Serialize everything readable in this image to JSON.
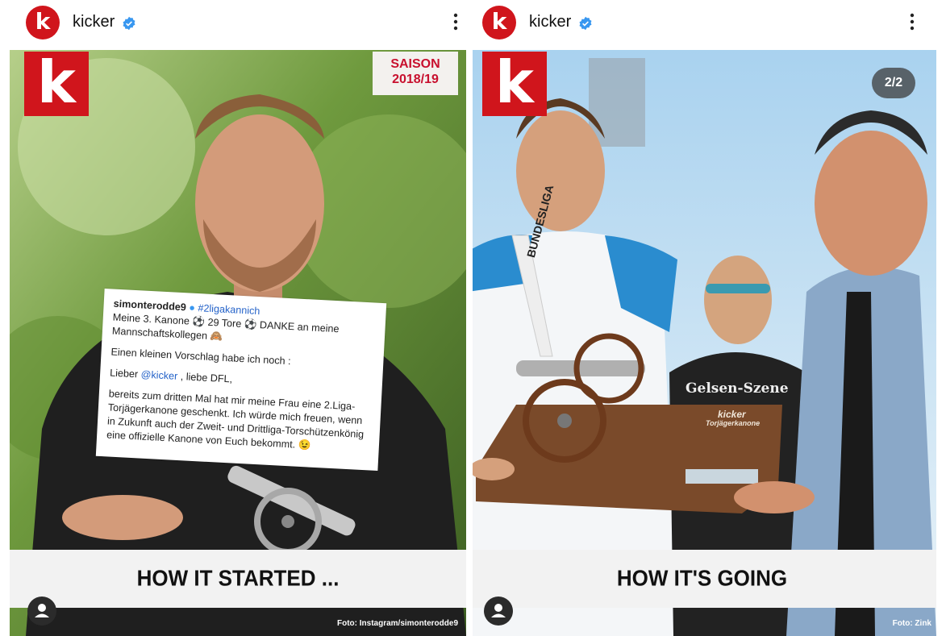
{
  "posts": [
    {
      "username": "kicker",
      "avatar_letter": "k",
      "logo_letter": "k",
      "badge": {
        "line1": "SAISON",
        "line2": "2018/19"
      },
      "caption": "HOW IT STARTED ...",
      "credit": "Foto: Instagram/simonterodde9",
      "quote": {
        "author": "simonterodde9",
        "hashtag": "#2ligakannich",
        "line1": "Meine 3. Kanone ⚽ 29 Tore ⚽ DANKE an meine Mannschaftskollegen 🙈",
        "line2": "Einen kleinen Vorschlag habe ich noch :",
        "line3_prefix": "Lieber ",
        "line3_mention": "@kicker",
        "line3_suffix": " , liebe DFL,",
        "line4": "bereits zum dritten Mal hat mir meine Frau eine 2.Liga-Torjägerkanone geschenkt. Ich würde mich freuen, wenn in Zukunft auch der Zweit- und Drittliga-Torschützenkönig eine offizielle Kanone von Euch bekommt. 😉"
      }
    },
    {
      "username": "kicker",
      "avatar_letter": "k",
      "logo_letter": "k",
      "counter": "2/2",
      "caption": "HOW IT'S GOING",
      "credit": "Foto: Zink",
      "plaque_title": "kicker",
      "plaque_subtitle": "Torjägerkanone",
      "shirt_text": "Gelsen-Szene",
      "banner_text": "BUNDESLIGA"
    }
  ],
  "colors": {
    "brand_red": "#d0151c",
    "verified_blue": "#3897f0",
    "caption_band": "#f2f2f2"
  },
  "icons": [
    "verified-icon",
    "more-options-icon",
    "user-tag-icon"
  ]
}
